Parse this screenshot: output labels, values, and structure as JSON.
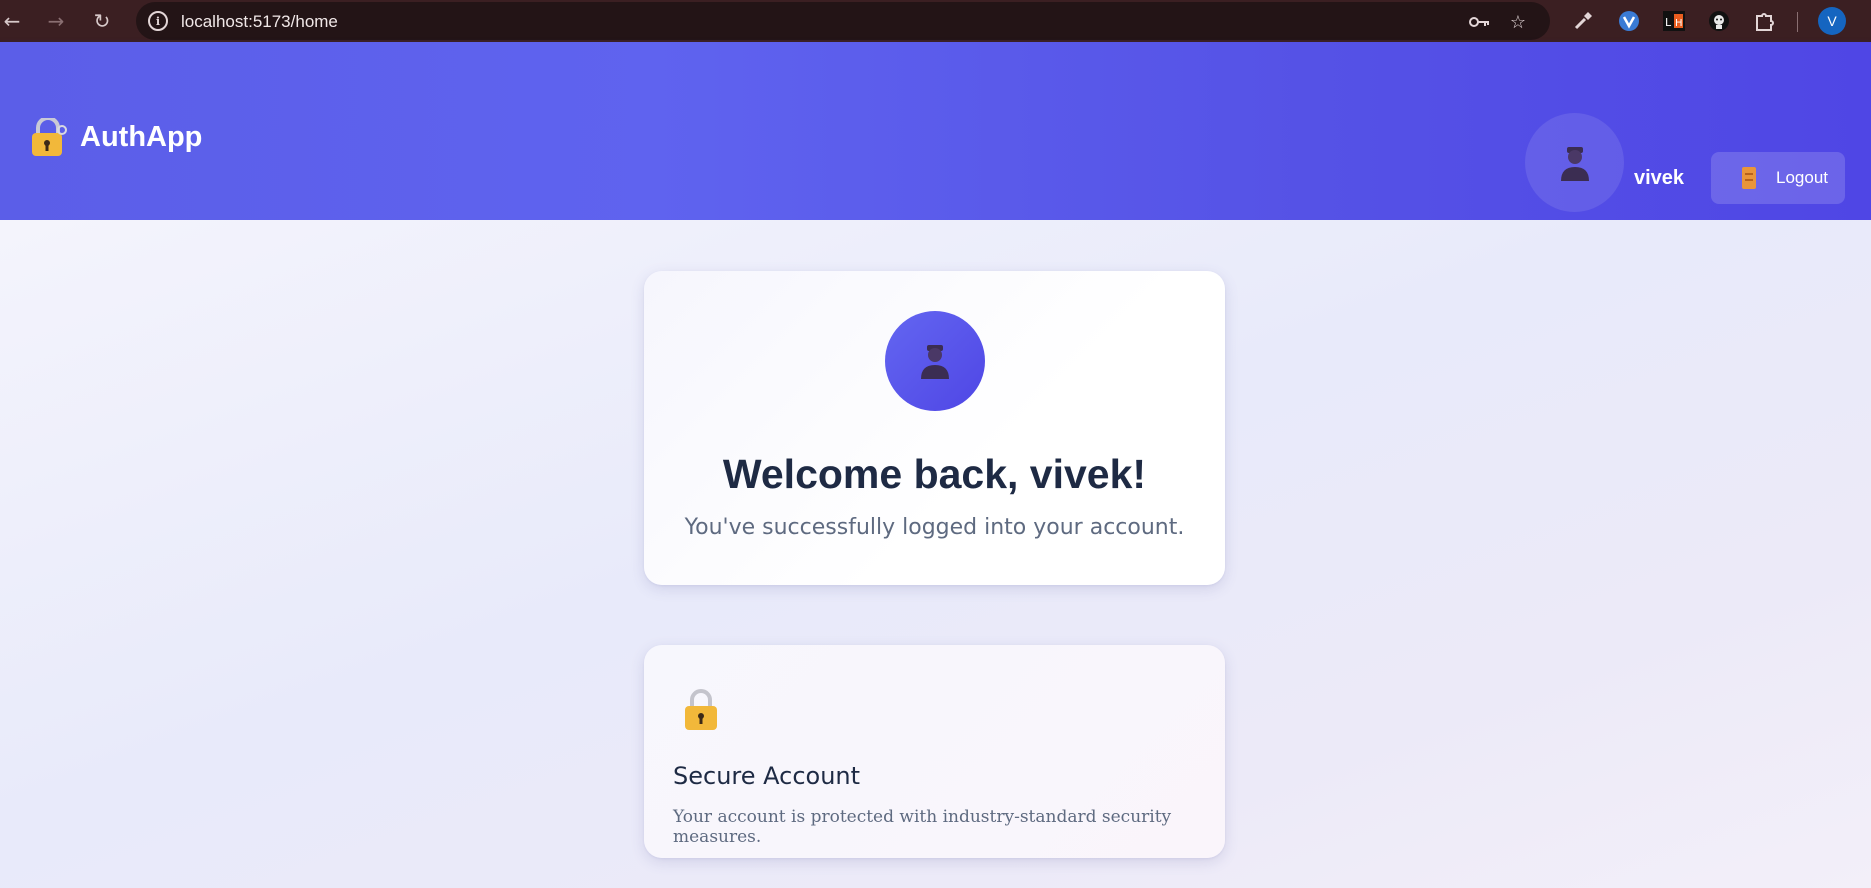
{
  "browser": {
    "url": "localhost:5173/home",
    "profile_initial": "V",
    "icons": [
      "back-icon",
      "forward-icon",
      "reload-icon",
      "site-info-icon",
      "password-key-icon",
      "bookmark-star-icon",
      "eyedropper-extension-icon",
      "vivaldi-extension-icon",
      "lighthouse-extension-icon",
      "github-extension-icon",
      "extensions-puzzle-icon"
    ]
  },
  "header": {
    "brand_icon": "lock-with-key-icon",
    "brand_title": "AuthApp",
    "avatar_icon": "user-silhouette-icon",
    "username": "vivek",
    "logout_icon": "door-icon",
    "logout_label": "Logout",
    "gradient_start": "#5b5ee8",
    "gradient_end": "#4f46e5"
  },
  "welcome_card": {
    "avatar_icon": "user-silhouette-icon",
    "title": "Welcome back, vivek!",
    "subtitle": "You've successfully logged into your account."
  },
  "feature_card": {
    "icon": "padlock-icon",
    "title": "Secure Account",
    "description": "Your account is protected with industry-standard security measures."
  },
  "colors": {
    "accent": "#4f46e5",
    "heading": "#1e2a44",
    "muted_text": "#5e6a80",
    "lock_yellow": "#f2b83a"
  }
}
